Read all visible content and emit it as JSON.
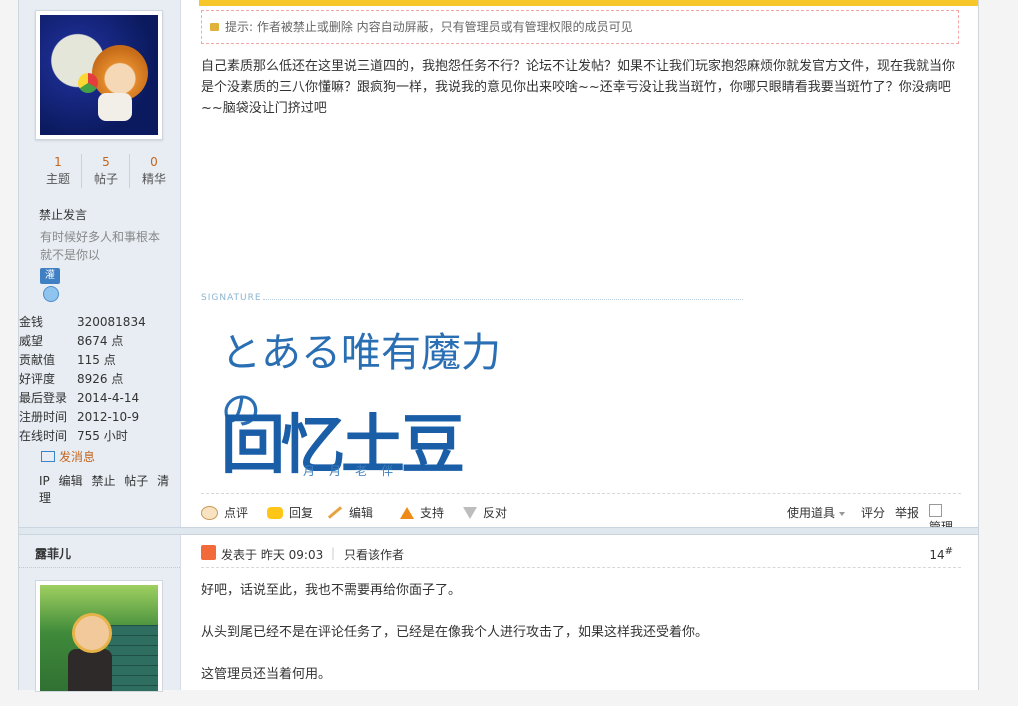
{
  "user1": {
    "stats": [
      {
        "value": "1",
        "label": "主题"
      },
      {
        "value": "5",
        "label": "帖子"
      },
      {
        "value": "0",
        "label": "精华"
      }
    ],
    "status": "禁止发言",
    "signature_short": "有时候好多人和事根本就不是你以",
    "medal_label": "灌",
    "info": [
      {
        "k": "金钱",
        "v": "320081834"
      },
      {
        "k": "威望",
        "v": "8674 点"
      },
      {
        "k": "贡献值",
        "v": "115 点"
      },
      {
        "k": "好评度",
        "v": "8926 点"
      },
      {
        "k": "最后登录",
        "v": "2014-4-14"
      },
      {
        "k": "注册时间",
        "v": "2012-10-9"
      },
      {
        "k": "在线时间",
        "v": "755 小时"
      }
    ],
    "send_message": "发消息",
    "admin_tools": [
      "IP",
      "编辑",
      "禁止",
      "帖子",
      "清理"
    ]
  },
  "post1": {
    "notice": "提示: 作者被禁止或删除 内容自动屏蔽，只有管理员或有管理权限的成员可见",
    "body": "自己素质那么低还在这里说三道四的，我抱怨任务不行？论坛不让发帖？如果不让我们玩家抱怨麻烦你就发官方文件，现在我就当你是个没素质的三八你懂嘛？跟疯狗一样，我说我的意见你出来咬啥~~还幸亏没让我当斑竹，你哪只眼睛看我要当斑竹了？你没病吧~~脑袋没让门挤过吧",
    "signature_label": "SIGNATURE",
    "sig_line1": "とある唯有魔力の",
    "sig_line2": "回忆土豆",
    "sig_line3": "月月老伴",
    "actions": {
      "comment": "点评",
      "reply": "回复",
      "edit": "编辑",
      "support": "支持",
      "oppose": "反对",
      "tools": "使用道具",
      "rate": "评分",
      "report": "举报",
      "manage": "管理"
    }
  },
  "user2": {
    "name": "露菲儿"
  },
  "post2": {
    "posted": "发表于 昨天 09:03",
    "only_author": "只看该作者",
    "floor": "14",
    "floor_mark": "#",
    "paragraphs": [
      "好吧，话说至此，我也不需要再给你面子了。",
      "从头到尾已经不是在评论任务了，已经是在像我个人进行攻击了，如果这样我还受着你。",
      "这管理员还当着何用。"
    ]
  },
  "colors": {
    "accent": "#f7c72a",
    "link_orange": "#c4661f",
    "sidebar_bg": "#e7edf3"
  }
}
